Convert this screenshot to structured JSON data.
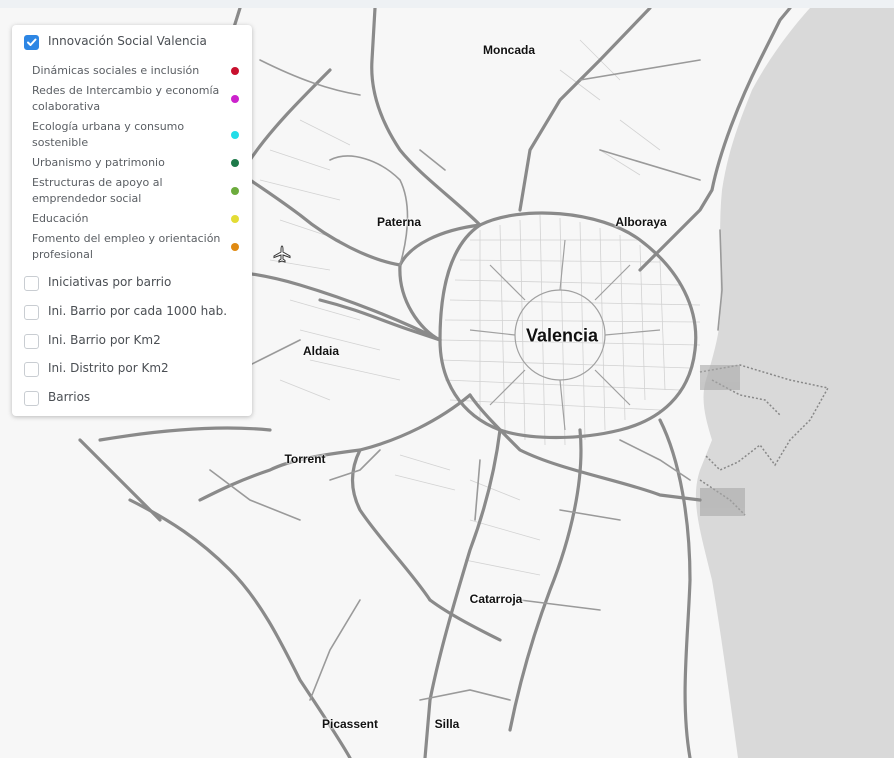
{
  "panel": {
    "main_layer": {
      "label": "Innovación Social Valencia",
      "checked": true
    },
    "legend": [
      {
        "label": "Dinámicas sociales e inclusión",
        "color": "#c8102e"
      },
      {
        "label": "Redes de Intercambio y economía colaborativa",
        "color": "#cc22cc"
      },
      {
        "label": "Ecología urbana y consumo sostenible",
        "color": "#22dde8"
      },
      {
        "label": "Urbanismo y patrimonio",
        "color": "#1e7a4a"
      },
      {
        "label": "Estructuras de apoyo al emprendedor social",
        "color": "#6cab3c"
      },
      {
        "label": "Educación",
        "color": "#e3dc35"
      },
      {
        "label": "Fomento del empleo y orientación profesional",
        "color": "#e08a12"
      }
    ],
    "layers": [
      {
        "label": "Iniciativas por barrio",
        "checked": false
      },
      {
        "label": "Ini. Barrio por cada 1000 hab.",
        "checked": false
      },
      {
        "label": "Ini. Barrio por Km2",
        "checked": false
      },
      {
        "label": "Ini. Distrito por Km2",
        "checked": false
      },
      {
        "label": "Barrios",
        "checked": false
      }
    ]
  },
  "map": {
    "places": {
      "valencia": "Valencia",
      "moncada": "Moncada",
      "paterna": "Paterna",
      "alboraya": "Alboraya",
      "aldaia": "Aldaia",
      "torrent": "Torrent",
      "catarroja": "Catarroja",
      "picassent": "Picassent",
      "silla": "Silla"
    },
    "icons": {
      "airport": "airplane-icon"
    },
    "colors": {
      "sea": "#d9d9d9",
      "land": "#f7f7f7",
      "road": "#8a8a8a"
    }
  }
}
